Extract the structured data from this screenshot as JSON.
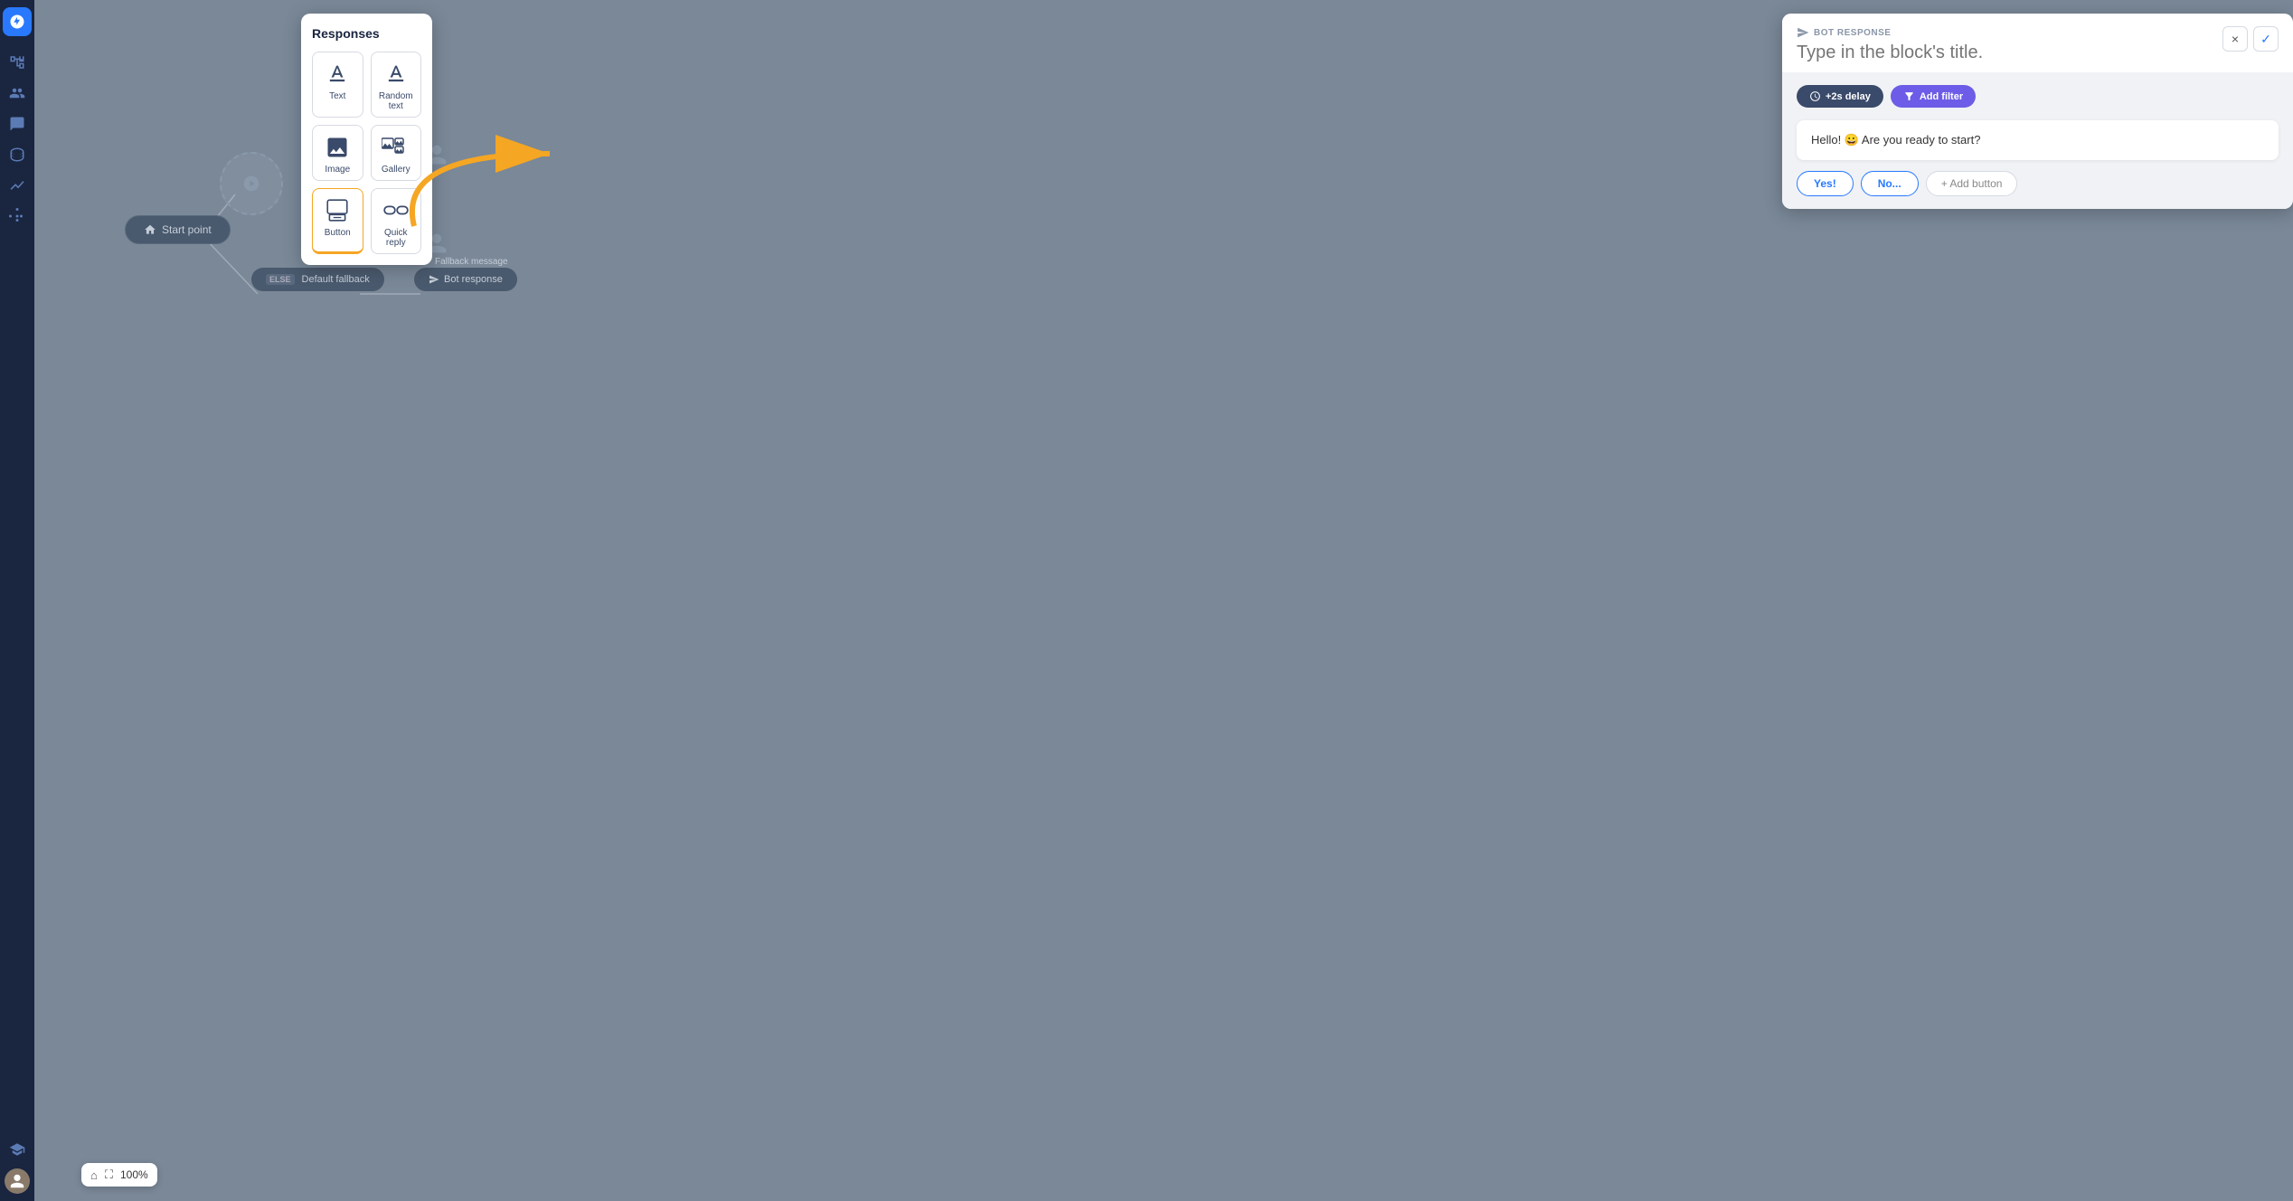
{
  "sidebar": {
    "logo_alt": "chat-icon",
    "icons": [
      {
        "name": "hierarchy-icon",
        "symbol": "⬡"
      },
      {
        "name": "users-icon",
        "symbol": "👥"
      },
      {
        "name": "cloud-icon",
        "symbol": "💬"
      },
      {
        "name": "database-icon",
        "symbol": "🗄"
      },
      {
        "name": "clock-icon",
        "symbol": "⏱"
      },
      {
        "name": "analytics-icon",
        "symbol": "📈"
      },
      {
        "name": "integrations-icon",
        "symbol": "⚙"
      }
    ],
    "bottom_icons": [
      {
        "name": "graduation-icon",
        "symbol": "🎓"
      }
    ]
  },
  "responses_panel": {
    "title": "Responses",
    "items": [
      {
        "id": "text",
        "label": "Text"
      },
      {
        "id": "random-text",
        "label": "Random text"
      },
      {
        "id": "image",
        "label": "Image"
      },
      {
        "id": "gallery",
        "label": "Gallery"
      },
      {
        "id": "button",
        "label": "Button"
      },
      {
        "id": "quick-reply",
        "label": "Quick reply"
      }
    ]
  },
  "bot_panel": {
    "label": "BOT RESPONSE",
    "title_placeholder": "Type in the block's title.",
    "delay_label": "+2s delay",
    "filter_label": "Add filter",
    "message": "Hello! 😀 Are you ready to start?",
    "buttons": [
      "Yes!",
      "No...",
      "+ Add button"
    ],
    "close_label": "×",
    "check_label": "✓"
  },
  "canvas": {
    "start_point_label": "Start point",
    "fallback_label": "Fallback message",
    "default_fallback_label": "Default fallback",
    "else_badge": "ELSE",
    "bot_response_label": "Bot response"
  },
  "zoom": {
    "level": "100%"
  }
}
